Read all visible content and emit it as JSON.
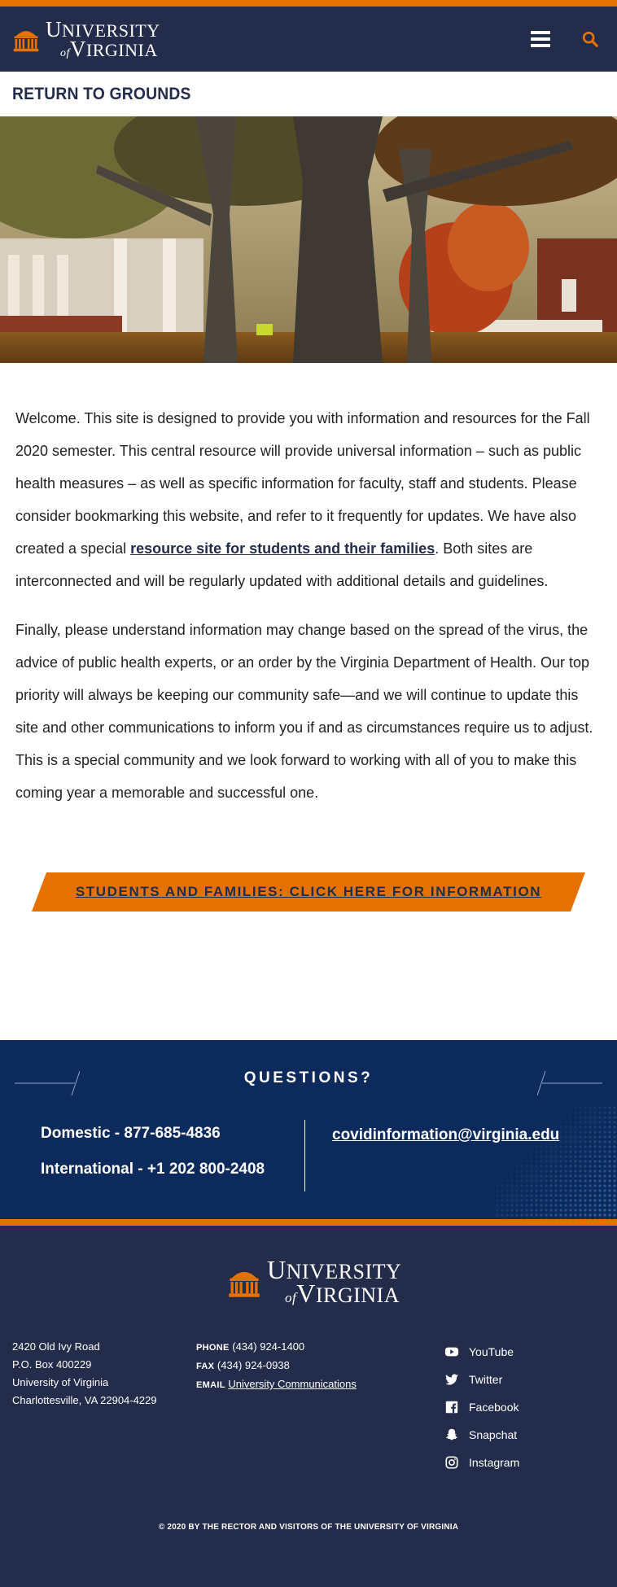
{
  "header": {
    "logo_line1": "NIVERSITY",
    "logo_line1_cap": "U",
    "logo_of": "of",
    "logo_line2_cap": "V",
    "logo_line2": "IRGINIA",
    "menu_icon": "hamburger-menu-icon",
    "search_icon": "search-icon"
  },
  "page": {
    "title": "RETURN TO GROUNDS"
  },
  "content": {
    "p1_text_a": "Welcome. This site is designed to provide you with information and resources for the Fall 2020 semester. This central resource will provide universal information – such as public health measures – as well as specific information for faculty, staff and students. Please consider bookmarking this website, and refer to it frequently for updates. We have also created a special ",
    "p1_link": "resource site for students and their families",
    "p1_text_b": ". Both sites are interconnected and will be regularly updated with additional details and guidelines.",
    "p2": "Finally, please understand information may change based on the spread of the virus, the advice of public health experts, or an order by the Virginia Department of Health. Our top priority will always be keeping our community safe—and we will continue to update this site and other communications to inform you if and as circumstances require us to adjust. This is a special community and we look forward to working with all of you to make this coming year a memorable and successful one.",
    "cta": "STUDENTS AND FAMILIES: CLICK HERE FOR INFORMATION"
  },
  "questions": {
    "title": "QUESTIONS?",
    "domestic": "Domestic - 877-685-4836",
    "international": "International - +1 202 800-2408",
    "email": "covidinformation@virginia.edu"
  },
  "footer": {
    "address": [
      "2420 Old Ivy Road",
      "P.O. Box 400229",
      "University of Virginia",
      "Charlottesville, VA 22904-4229"
    ],
    "phone_label": "PHONE",
    "phone": "(434) 924-1400",
    "fax_label": "FAX",
    "fax": "(434) 924-0938",
    "email_label": "EMAIL",
    "email_link": "University Communications",
    "social": [
      {
        "label": "YouTube",
        "icon": "youtube-icon"
      },
      {
        "label": "Twitter",
        "icon": "twitter-icon"
      },
      {
        "label": "Facebook",
        "icon": "facebook-icon"
      },
      {
        "label": "Snapchat",
        "icon": "snapchat-icon"
      },
      {
        "label": "Instagram",
        "icon": "instagram-icon"
      }
    ],
    "copyright": "© 2020 BY THE RECTOR AND VISITORS OF THE UNIVERSITY OF VIRGINIA"
  },
  "colors": {
    "navy": "#232d4b",
    "orange": "#e57200",
    "questions_bg": "#0d2a5c"
  }
}
